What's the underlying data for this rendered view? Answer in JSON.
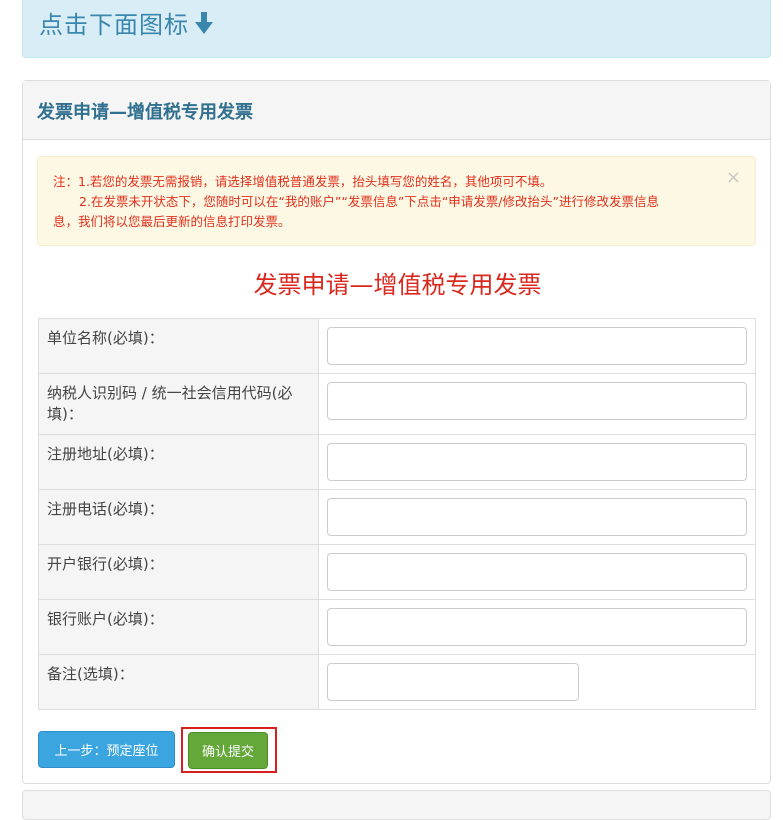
{
  "banner": {
    "text": "点击下面图标",
    "icon": "arrow-down-icon"
  },
  "panel": {
    "heading": "发票申请—增值税专用发票"
  },
  "notice": {
    "line1": "注：1.若您的发票无需报销，请选择增值税普通发票，抬头填写您的姓名，其他项可不填。",
    "line2": "2.在发票未开状态下，您随时可以在“我的账户”“发票信息”下点击“申请发票/修改抬头”进行修改发票信息",
    "line3": "息，我们将以您最后更新的信息打印发票。",
    "close": "×"
  },
  "form": {
    "title": "发票申请—增值税专用发票",
    "fields": [
      {
        "label": "单位名称(必填)：",
        "value": ""
      },
      {
        "label": "纳税人识别码 / 统一社会信用代码(必填)：",
        "value": ""
      },
      {
        "label": "注册地址(必填)：",
        "value": ""
      },
      {
        "label": "注册电话(必填)：",
        "value": ""
      },
      {
        "label": "开户银行(必填)：",
        "value": ""
      },
      {
        "label": "银行账户(必填)：",
        "value": ""
      },
      {
        "label": "备注(选填)：",
        "value": ""
      }
    ]
  },
  "buttons": {
    "prev": "上一步：预定座位",
    "submit": "确认提交"
  },
  "colors": {
    "notice_text": "#e0301e",
    "form_title": "#d9281e",
    "prev_button": "#3ba5e0",
    "submit_button": "#64a83a",
    "highlight_border": "#d8201e",
    "banner_text": "#3a87ad"
  }
}
